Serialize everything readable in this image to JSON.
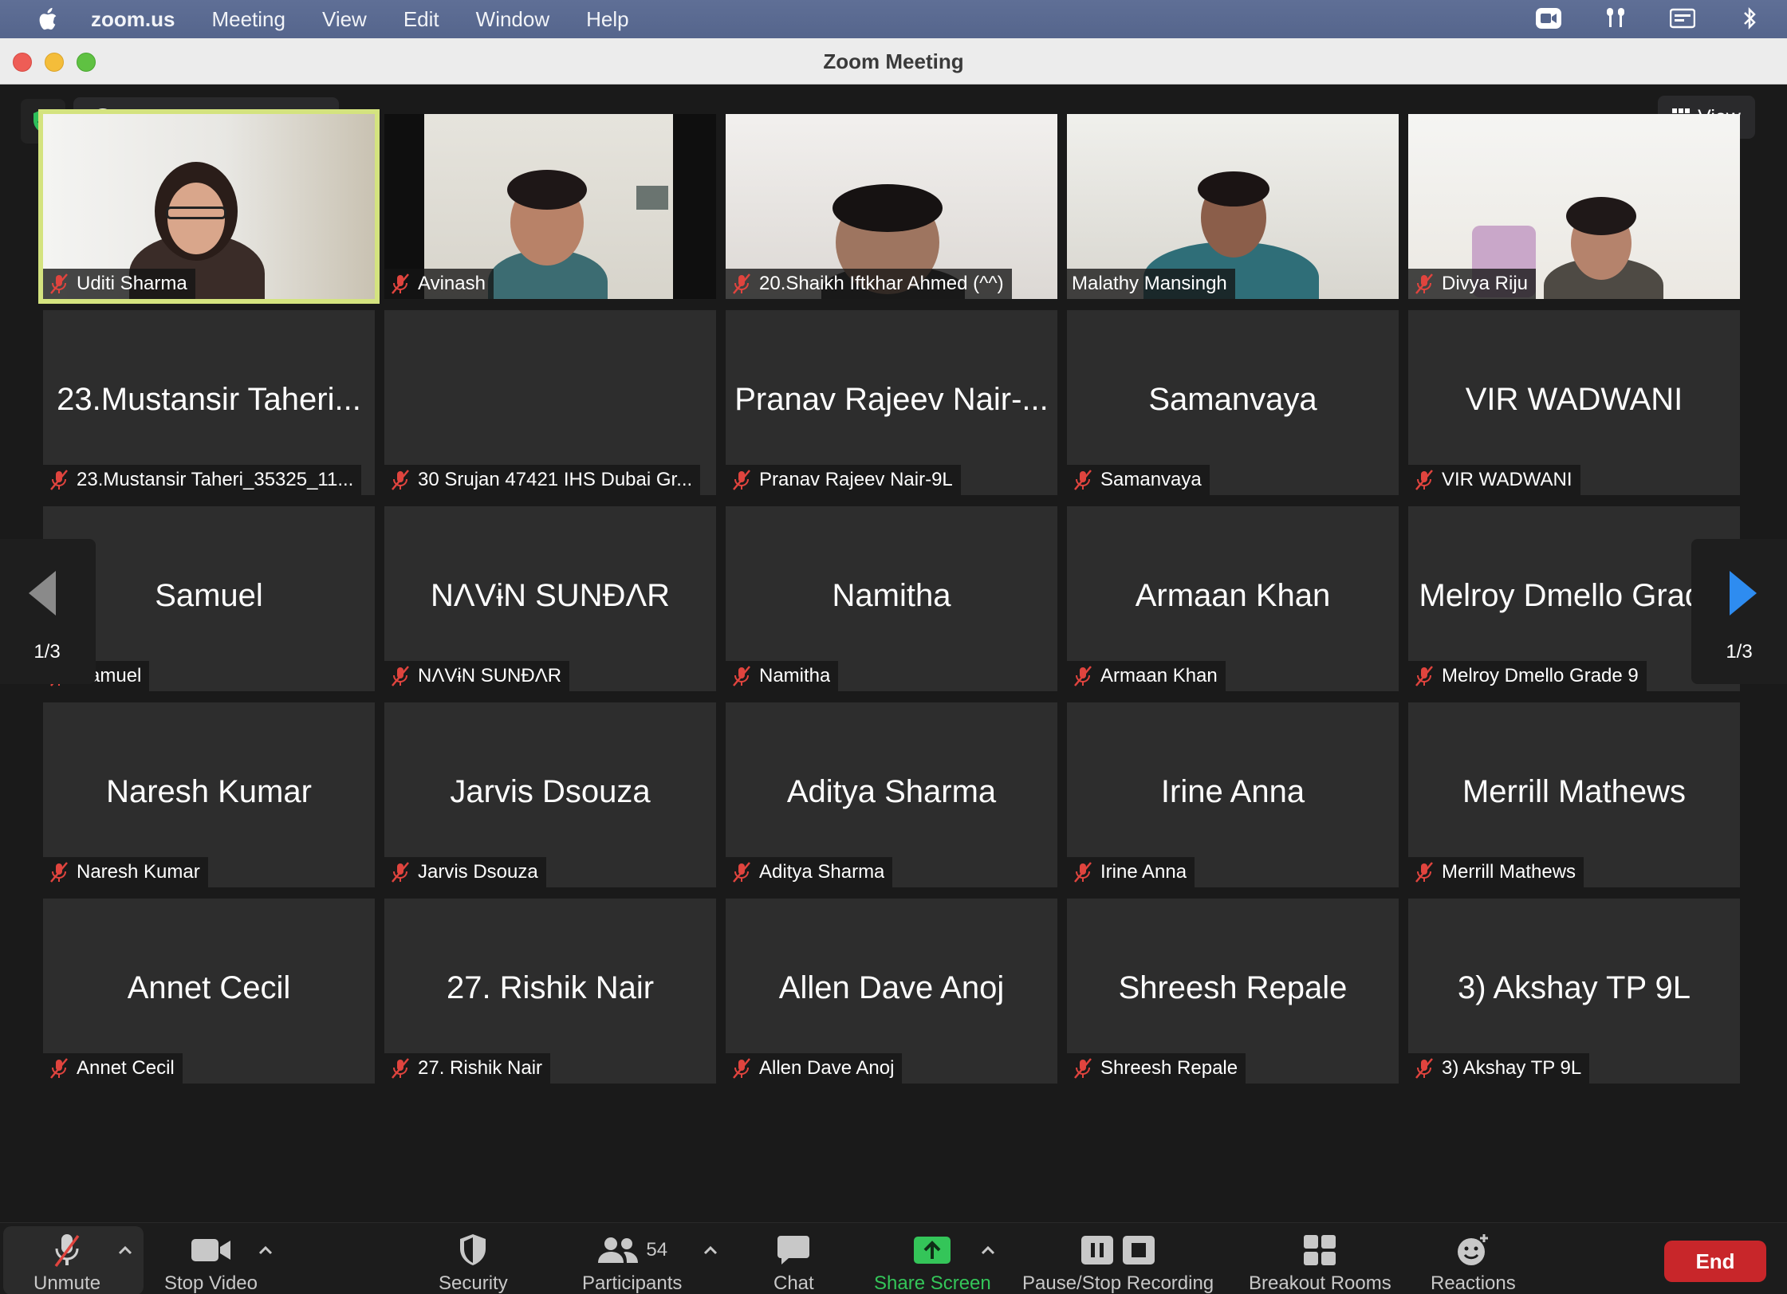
{
  "menubar": {
    "app_name": "zoom.us",
    "items": [
      "Meeting",
      "View",
      "Edit",
      "Window",
      "Help"
    ],
    "right_icons": [
      "zoom-camera-icon",
      "airpods-icon",
      "menu-extra-icon",
      "bluetooth-icon"
    ]
  },
  "window": {
    "title": "Zoom Meeting"
  },
  "meeting_top": {
    "recording_label": "Recording...",
    "view_label": "View"
  },
  "tiles": [
    {
      "big": "",
      "tag": "Uditi Sharma",
      "video": true,
      "active": true
    },
    {
      "big": "",
      "tag": "Avinash",
      "video": true
    },
    {
      "big": "",
      "tag": "20.Shaikh Iftkhar Ahmed (^^)",
      "video": true
    },
    {
      "big": "",
      "tag": "Malathy Mansingh",
      "video": true,
      "unmuted": true
    },
    {
      "big": "",
      "tag": "Divya Riju",
      "video": true
    },
    {
      "big": "23.Mustansir Taheri...",
      "tag": "23.Mustansir Taheri_35325_11..."
    },
    {
      "big": "",
      "tag": "30 Srujan 47421 IHS Dubai Gr..."
    },
    {
      "big": "Pranav Rajeev Nair-...",
      "tag": "Pranav Rajeev Nair-9L"
    },
    {
      "big": "Samanvaya",
      "tag": "Samanvaya"
    },
    {
      "big": "VIR WADWANI",
      "tag": "VIR WADWANI"
    },
    {
      "big": "Samuel",
      "tag": "Samuel"
    },
    {
      "big": "NΛVɨN SUNÐΛR",
      "tag": "NΛVɨN SUNÐΛR"
    },
    {
      "big": "Namitha",
      "tag": "Namitha"
    },
    {
      "big": "Armaan Khan",
      "tag": "Armaan Khan"
    },
    {
      "big": "Melroy Dmello Grad...",
      "tag": "Melroy Dmello Grade 9"
    },
    {
      "big": "Naresh Kumar",
      "tag": "Naresh Kumar"
    },
    {
      "big": "Jarvis Dsouza",
      "tag": "Jarvis Dsouza"
    },
    {
      "big": "Aditya Sharma",
      "tag": "Aditya Sharma"
    },
    {
      "big": "Irine Anna",
      "tag": "Irine Anna"
    },
    {
      "big": "Merrill Mathews",
      "tag": "Merrill Mathews"
    },
    {
      "big": "Annet Cecil",
      "tag": "Annet Cecil"
    },
    {
      "big": "27. Rishik Nair",
      "tag": "27. Rishik Nair"
    },
    {
      "big": "Allen Dave Anoj",
      "tag": "Allen Dave Anoj"
    },
    {
      "big": "Shreesh Repale",
      "tag": "Shreesh Repale"
    },
    {
      "big": "3) Akshay TP 9L",
      "tag": "3) Akshay TP 9L"
    }
  ],
  "pager": {
    "left": "1/3",
    "right": "1/3"
  },
  "toolbar": {
    "unmute": "Unmute",
    "stop_video": "Stop Video",
    "security": "Security",
    "participants": "Participants",
    "participants_count": "54",
    "chat": "Chat",
    "share_screen": "Share Screen",
    "pause_stop_recording": "Pause/Stop Recording",
    "breakout_rooms": "Breakout Rooms",
    "reactions": "Reactions",
    "end": "End"
  },
  "colors": {
    "active_speaker_border": "#d4e37f",
    "share_green": "#34c559",
    "end_red": "#c8262a",
    "muted_red": "#e0443e"
  }
}
